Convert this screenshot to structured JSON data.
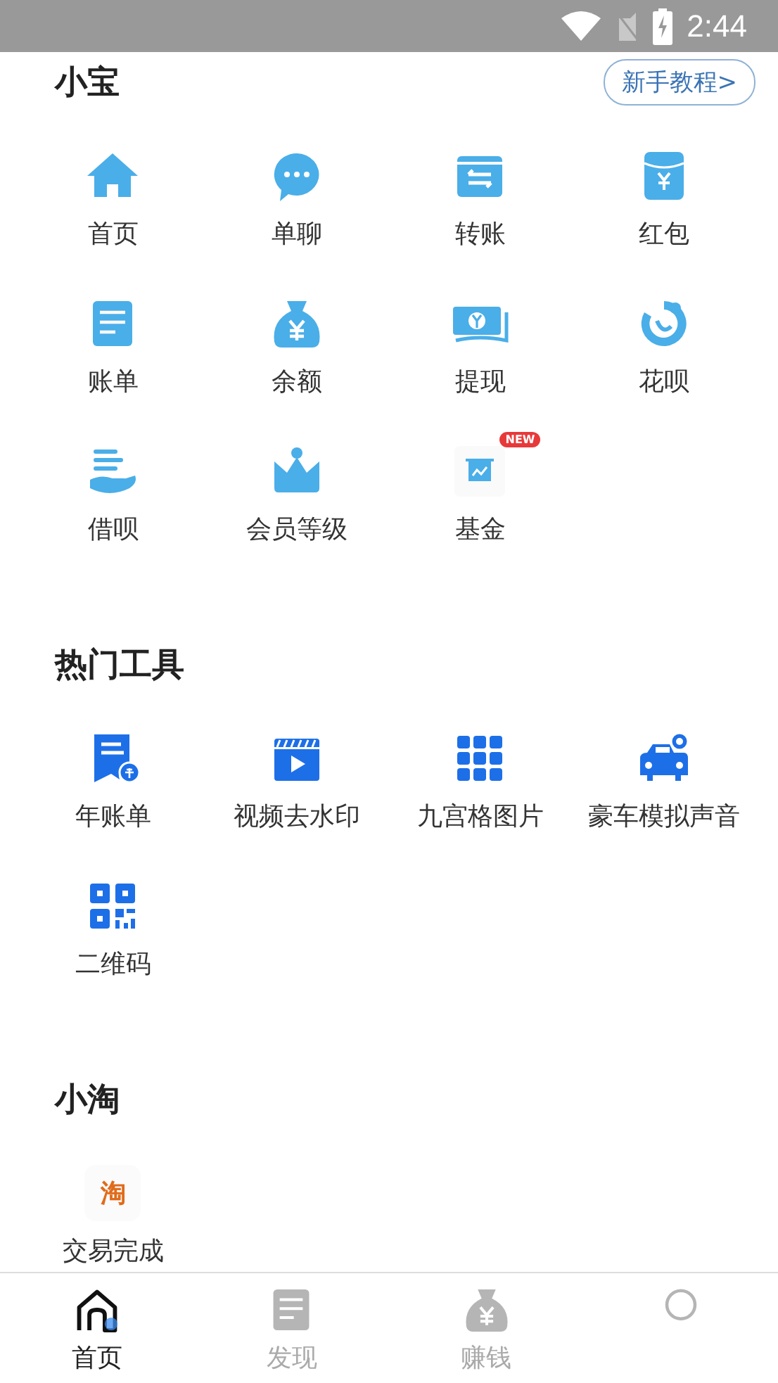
{
  "status_bar": {
    "time": "2:44"
  },
  "sections": [
    {
      "title": "小宝",
      "kind": "light",
      "button": "新手教程>",
      "items": [
        {
          "label": "首页",
          "kind": "house"
        },
        {
          "label": "单聊",
          "kind": "chat"
        },
        {
          "label": "转账",
          "kind": "transfer"
        },
        {
          "label": "红包",
          "kind": "envelope"
        },
        {
          "label": "账单",
          "kind": "document"
        },
        {
          "label": "余额",
          "kind": "moneybag"
        },
        {
          "label": "提现",
          "kind": "banknote"
        },
        {
          "label": "花呗",
          "kind": "swirl"
        },
        {
          "label": "借呗",
          "kind": "hand"
        },
        {
          "label": "会员等级",
          "kind": "crown"
        },
        {
          "label": "基金",
          "kind": "chart",
          "badge": "NEW"
        }
      ]
    },
    {
      "title": "热门工具",
      "kind": "dark",
      "items": [
        {
          "label": "年账单",
          "kind": "receipt"
        },
        {
          "label": "视频去水印",
          "kind": "clapper"
        },
        {
          "label": "九宫格图片",
          "kind": "grid"
        },
        {
          "label": "豪车模拟声音",
          "kind": "car"
        },
        {
          "label": "二维码",
          "kind": "qrcode"
        }
      ]
    },
    {
      "title": "小淘",
      "kind": "taobao",
      "items": [
        {
          "label": "交易完成",
          "kind": "taobao",
          "glyph": "淘"
        }
      ]
    }
  ],
  "nav": [
    {
      "label": "首页",
      "kind": "home",
      "selected": true
    },
    {
      "label": "发现",
      "kind": "document",
      "selected": false
    },
    {
      "label": "赚钱",
      "kind": "moneybag",
      "selected": false
    },
    {
      "kind": "person",
      "selected": false
    }
  ]
}
